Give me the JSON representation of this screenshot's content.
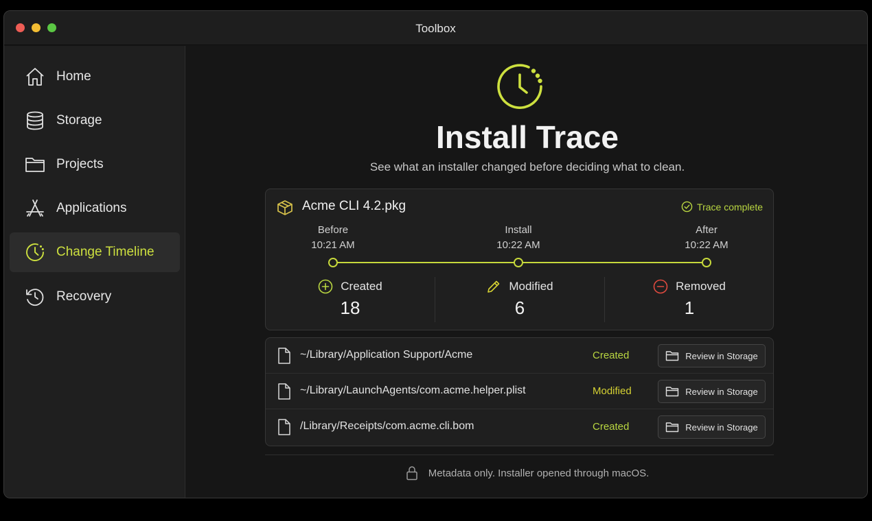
{
  "window": {
    "title": "Toolbox"
  },
  "sidebar": {
    "items": [
      {
        "label": "Home",
        "icon": "home-icon"
      },
      {
        "label": "Storage",
        "icon": "database-icon"
      },
      {
        "label": "Projects",
        "icon": "folder-icon"
      },
      {
        "label": "Applications",
        "icon": "app-store-icon"
      },
      {
        "label": "Change Timeline",
        "icon": "clock-icon",
        "active": true
      },
      {
        "label": "Recovery",
        "icon": "history-icon"
      }
    ]
  },
  "hero": {
    "icon": "clock-icon",
    "title": "Install Trace",
    "subtitle": "See what an installer changed before deciding what to clean."
  },
  "trace": {
    "package_name": "Acme CLI 4.2.pkg",
    "status": "Trace complete",
    "stages": [
      {
        "label": "Before",
        "time": "10:21 AM"
      },
      {
        "label": "Install",
        "time": "10:22 AM"
      },
      {
        "label": "After",
        "time": "10:22 AM"
      }
    ],
    "stats": [
      {
        "label": "Created",
        "value": "18",
        "icon": "plus-circle-icon"
      },
      {
        "label": "Modified",
        "value": "6",
        "icon": "pencil-icon"
      },
      {
        "label": "Removed",
        "value": "1",
        "icon": "minus-circle-icon"
      }
    ]
  },
  "changes": [
    {
      "path": "~/Library/Application Support/Acme",
      "change": "Created",
      "action": "Review in Storage"
    },
    {
      "path": "~/Library/LaunchAgents/com.acme.helper.plist",
      "change": "Modified",
      "action": "Review in Storage"
    },
    {
      "path": "/Library/Receipts/com.acme.cli.bom",
      "change": "Created",
      "action": "Review in Storage"
    }
  ],
  "footer": {
    "text": "Metadata only. Installer opened through macOS."
  },
  "colors": {
    "accent": "#c7d93b",
    "created": "#b9d641",
    "modified": "#d6d233",
    "removed": "#e04a3f"
  }
}
